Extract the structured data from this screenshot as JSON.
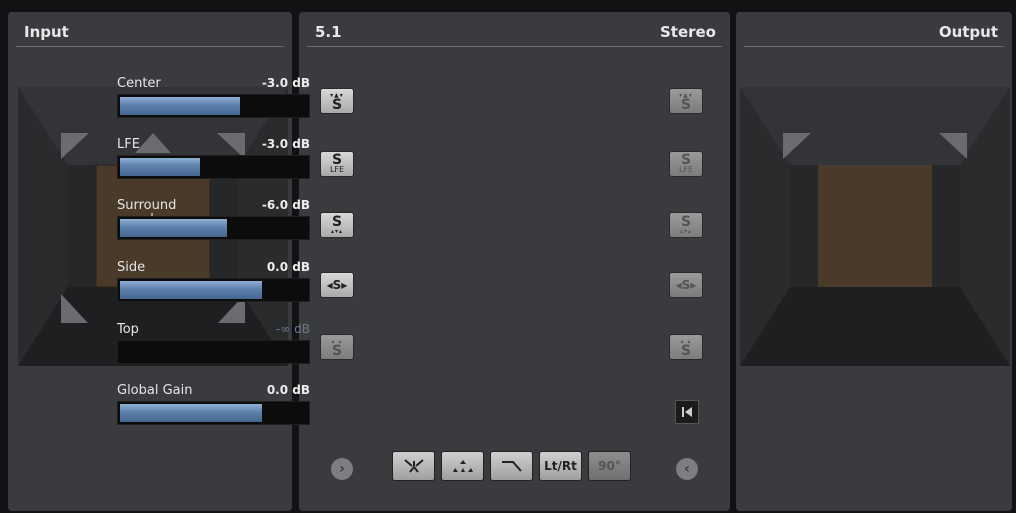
{
  "input": {
    "title": "Input"
  },
  "center": {
    "format_left": "5.1",
    "format_right": "Stereo",
    "sliders": [
      {
        "label": "Center",
        "value": "-3.0 dB",
        "level": 0.64
      },
      {
        "label": "LFE",
        "value": "-3.0 dB",
        "level": 0.43
      },
      {
        "label": "Surround",
        "value": "-6.0 dB",
        "level": 0.57
      },
      {
        "label": "Side",
        "value": "0.0 dB",
        "level": 0.76
      },
      {
        "label": "Top",
        "value": "-∞ dB",
        "level": 0.0
      },
      {
        "label": "Global Gain",
        "value": "0.0 dB",
        "level": 0.76
      }
    ],
    "bottom_buttons": {
      "ltrt": "Lt/Rt",
      "deg90": "90°"
    }
  },
  "output": {
    "title": "Output"
  },
  "colors": {
    "panel_bg": "#3a3b3e",
    "slider_fill": "#5d80aa",
    "room_floor": "#4a3a2a"
  },
  "icons": {
    "crosshair": "crosshair-icon",
    "expand": "chevron-right-icon",
    "collapse": "chevron-left-icon",
    "reset": "reset-to-start-icon"
  }
}
